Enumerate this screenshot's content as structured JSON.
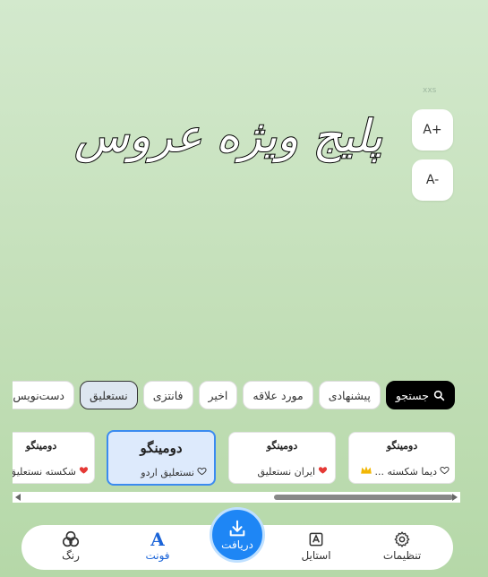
{
  "canvas": {
    "text": "پلیج ویژه عروس",
    "tiny_label": "xxs"
  },
  "zoom": {
    "plus": "A+",
    "minus": "A-"
  },
  "chips": [
    {
      "id": "search",
      "label": "جستجو"
    },
    {
      "id": "suggested",
      "label": "پیشنهادی"
    },
    {
      "id": "favorites",
      "label": "مورد علاقه"
    },
    {
      "id": "recent",
      "label": "اخیر"
    },
    {
      "id": "fantasy",
      "label": "فانتزی"
    },
    {
      "id": "nastaliq",
      "label": "نستعلیق"
    },
    {
      "id": "handwritten",
      "label": "دست‌نویس"
    }
  ],
  "cards": [
    {
      "name": "دومینگو",
      "label": "دیما شکسته ...",
      "favorite": false,
      "premium": true
    },
    {
      "name": "دومینگو",
      "label": "ایران نستعلیق",
      "favorite": true,
      "premium": false
    },
    {
      "name": "دومینگو",
      "label": "نستعلیق اردو",
      "favorite": false,
      "premium": false
    },
    {
      "name": "دومینگو",
      "label": "شکسته نستعلیق",
      "favorite": true,
      "premium": false
    }
  ],
  "nav": {
    "settings": "تنظیمات",
    "style": "استایل",
    "download": "دریافت",
    "font": "فونت",
    "color": "رنگ"
  },
  "colors": {
    "accent": "#1e86f5",
    "active": "#1b64d8",
    "heart": "#e53935",
    "crown": "#f2b705"
  }
}
